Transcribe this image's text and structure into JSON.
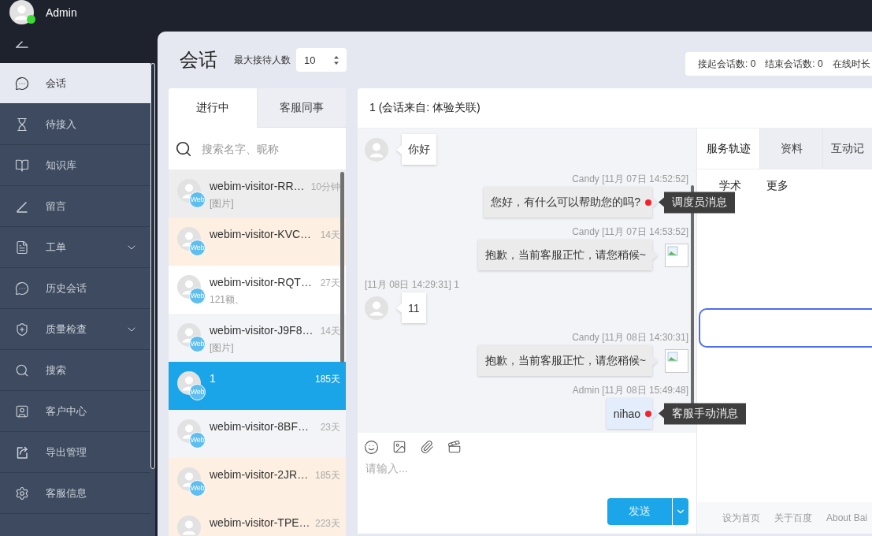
{
  "user": {
    "name": "Admin",
    "online": true
  },
  "sidebar": {
    "items": [
      {
        "label": "会话",
        "selected": true,
        "submenu": false
      },
      {
        "label": "待接入",
        "selected": false,
        "submenu": false
      },
      {
        "label": "知识库",
        "selected": false,
        "submenu": false
      },
      {
        "label": "留言",
        "selected": false,
        "submenu": false
      },
      {
        "label": "工单",
        "selected": false,
        "submenu": true
      },
      {
        "label": "历史会话",
        "selected": false,
        "submenu": false
      },
      {
        "label": "质量检查",
        "selected": false,
        "submenu": true
      },
      {
        "label": "搜索",
        "selected": false,
        "submenu": false
      },
      {
        "label": "客户中心",
        "selected": false,
        "submenu": false
      },
      {
        "label": "导出管理",
        "selected": false,
        "submenu": false
      },
      {
        "label": "客服信息",
        "selected": false,
        "submenu": false
      }
    ]
  },
  "page": {
    "title": "会话",
    "max_label": "最大接待人数",
    "max_value": "10",
    "stats": [
      "接起会话数: 0",
      "结束会话数: 0",
      "在线时长"
    ]
  },
  "conversation_list": {
    "tabs": [
      {
        "label": "进行中",
        "selected": true
      },
      {
        "label": "客服同事",
        "selected": false
      }
    ],
    "search": {
      "placeholder": "搜索名字、昵称"
    },
    "items": [
      {
        "name": "webim-visitor-RR…",
        "time": "10分钟",
        "preview": "[图片]",
        "badge": "Web",
        "selected": false,
        "color": "#ededed"
      },
      {
        "name": "webim-visitor-KVC…",
        "time": "14天",
        "badge": "Web",
        "selected": false,
        "color": "#fdefe2"
      },
      {
        "name": "webim-visitor-RQT…",
        "time": "27天",
        "preview": "121额、",
        "badge": "Web",
        "selected": false,
        "color": "#ffffff"
      },
      {
        "name": "webim-visitor-J9F8…",
        "time": "14天",
        "preview": "[图片]",
        "badge": "Web",
        "selected": false,
        "color": "#f3f4f8"
      },
      {
        "name": "1",
        "time": "185天",
        "badge": "Web",
        "selected": true
      },
      {
        "name": "webim-visitor-8BF…",
        "time": "23天",
        "badge": "Web",
        "selected": false,
        "color": "#f3f4f8"
      },
      {
        "name": "webim-visitor-2JR…",
        "time": "185天",
        "badge": "Web",
        "selected": false,
        "color": "#fdefe2"
      },
      {
        "name": "webim-visitor-TPE…",
        "time": "223天",
        "selected": false,
        "color": "#fdefe2"
      }
    ]
  },
  "chat": {
    "title": "1 (会话来自: 体验关联)",
    "messages": [
      {
        "kind": "visitor",
        "text": "你好",
        "marked": false
      },
      {
        "kind": "agent",
        "meta": "Candy [11月 07日 14:52:52]",
        "text": "您好，有什么可以帮助您的吗?",
        "marked": true,
        "tooltip": "调度员消息"
      },
      {
        "kind": "agent",
        "meta": "Candy [11月 07日 14:53:52]",
        "text": "抱歉，当前客服正忙，请您稍候~",
        "marked": false
      },
      {
        "kind": "visitor",
        "meta": "[11月 08日 14:29:31] 1",
        "text": "11",
        "marked": false
      },
      {
        "kind": "agent",
        "meta": "Candy [11月 08日 14:30:31]",
        "text": "抱歉，当前客服正忙，请您稍候~",
        "marked": false
      },
      {
        "kind": "self",
        "meta": "Admin [11月 08日 15:49:48]",
        "text": "nihao",
        "marked": true,
        "tooltip": "客服手动消息"
      }
    ],
    "composer": {
      "placeholder": "请输入...",
      "send": "发送"
    }
  },
  "side_panel": {
    "tabs": [
      {
        "label": "服务轨迹",
        "selected": true
      },
      {
        "label": "资料",
        "selected": false
      },
      {
        "label": "互动记",
        "selected": false
      }
    ],
    "links": [
      "学术",
      "更多"
    ],
    "footer_links": [
      "设为首页",
      "关于百度",
      "About Bai"
    ]
  }
}
